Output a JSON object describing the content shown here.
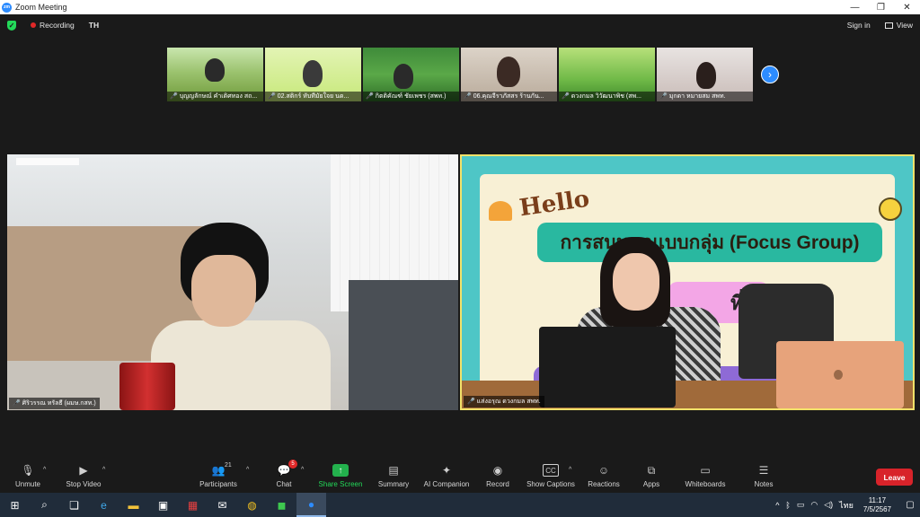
{
  "window": {
    "title": "Zoom Meeting",
    "app_icon_text": "zm",
    "controls": [
      "—",
      "❐",
      "✕"
    ]
  },
  "topbar": {
    "recording_label": "Recording",
    "user_initials": "TH",
    "sign_in": "Sign in",
    "view": "View"
  },
  "thumbnails": [
    {
      "name": "บุญญลักษณ์ คำเติศทอง สถ..."
    },
    {
      "name": "02.สติกร์ หับทีมัยใจย นด..."
    },
    {
      "name": "กิตติคัณฑ์ ชัยเพชร (สพท.)"
    },
    {
      "name": "06.คุณจีราภัสสร ร้านกัน..."
    },
    {
      "name": "ดวงกมล วิวัฒนาพิช (สพ..."
    },
    {
      "name": "มุกดา หมายสม สพท."
    }
  ],
  "main": {
    "left_name": "ศิริวรรณ ทรัลธี (ผมษ.กสท.)",
    "right_name": "แส่งอรุณ ดวงกมล สพท.",
    "slide": {
      "hello": "Hello",
      "title": "การสนทนาแบบกลุ่ม (Focus Group)",
      "group": "ที่ 3"
    }
  },
  "toolbar": {
    "unmute": "Unmute",
    "stop_video": "Stop Video",
    "participants": "Participants",
    "participants_count": "21",
    "chat": "Chat",
    "chat_badge": "5",
    "share_screen": "Share Screen",
    "summary": "Summary",
    "ai_companion": "AI Companion",
    "record": "Record",
    "show_captions": "Show Captions",
    "reactions": "Reactions",
    "apps": "Apps",
    "whiteboards": "Whiteboards",
    "notes": "Notes",
    "leave": "Leave"
  },
  "taskbar": {
    "lang": "ไทย",
    "time": "11:17",
    "date": "7/5/2567"
  },
  "colors": {
    "zoom_blue": "#2d8cff",
    "leave_red": "#d8232a",
    "share_green": "#23b14d",
    "active_speaker": "#f3e26a"
  }
}
